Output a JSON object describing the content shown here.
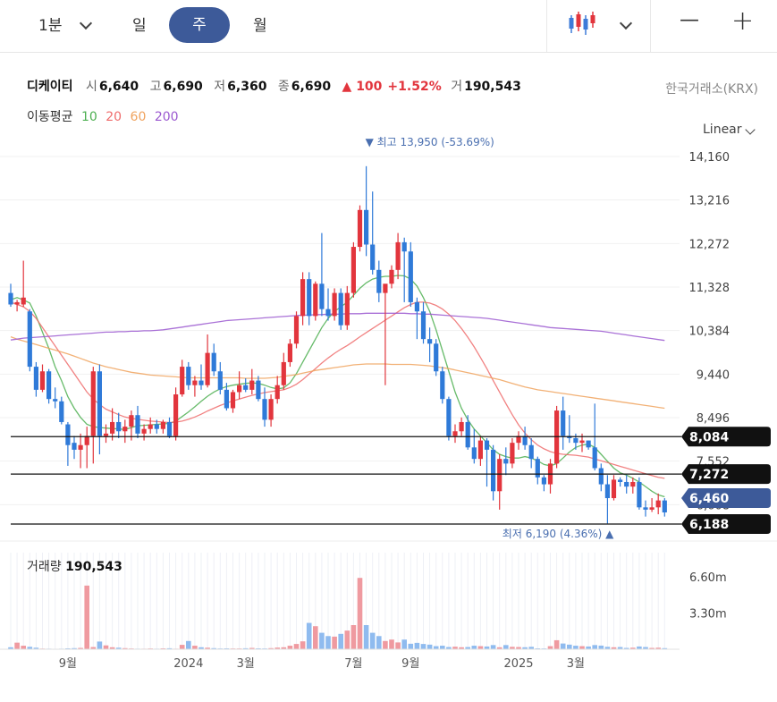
{
  "toolbar": {
    "interval": "1분",
    "tabs": [
      "일",
      "주",
      "월"
    ],
    "active_tab": "주",
    "zoom_out": "—",
    "zoom_in": "+"
  },
  "stock": {
    "name": "디케이티",
    "open_label": "시",
    "open": "6,640",
    "high_label": "고",
    "high": "6,690",
    "low_label": "저",
    "low": "6,360",
    "close_label": "종",
    "close": "6,690",
    "change": "▲ 100",
    "change_pct": "+1.52%",
    "volume_label": "거",
    "volume": "190,543",
    "exchange": "한국거래소(KRX)"
  },
  "moving_average": {
    "label": "이동평균",
    "periods": [
      {
        "name": "10",
        "color": "#4caf50"
      },
      {
        "name": "20",
        "color": "#ef6c6c"
      },
      {
        "name": "60",
        "color": "#f0a35e"
      },
      {
        "name": "200",
        "color": "#9b59d0"
      }
    ]
  },
  "scale": "Linear",
  "chart_data": {
    "type": "candlestick",
    "ylim": [
      6188,
      14160
    ],
    "y_ticks": [
      14160,
      13216,
      12272,
      11328,
      10384,
      9440,
      8496,
      7552,
      6608
    ],
    "y_tick_labels": [
      "14,160",
      "13,216",
      "12,272",
      "11,328",
      "10,384",
      "9,440",
      "8,496",
      "7,552",
      "6,608"
    ],
    "x_tick_labels": [
      {
        "label": "9월",
        "index": 9
      },
      {
        "label": "2024",
        "index": 28
      },
      {
        "label": "3월",
        "index": 37
      },
      {
        "label": "7월",
        "index": 54
      },
      {
        "label": "9월",
        "index": 63
      },
      {
        "label": "2025",
        "index": 80
      },
      {
        "label": "3월",
        "index": 89
      }
    ],
    "horizontal_lines": [
      {
        "value": 8084,
        "label": "8,084",
        "color": "#111111"
      },
      {
        "value": 7272,
        "label": "7,272",
        "color": "#111111"
      },
      {
        "value": 6188,
        "label": "6,188",
        "color": "#111111"
      }
    ],
    "current_price": {
      "value": 6460,
      "label": "6,460",
      "color": "#3d5a99"
    },
    "high_marker": {
      "text": "▼ 최고 13,950 (-53.69%)",
      "index": 56,
      "value": 13950
    },
    "low_marker": {
      "text": "최저 6,190 (4.36%) ▲",
      "index": 94,
      "value": 6190
    },
    "volume_label": "거래량",
    "volume_value": "190,543",
    "volume_ticks": [
      {
        "value": 6.6,
        "label": "6.60m"
      },
      {
        "value": 3.3,
        "label": "3.30m"
      }
    ],
    "volume_max": 8.8,
    "candles": [
      [
        11200,
        11400,
        10900,
        10950
      ],
      [
        10950,
        11050,
        10800,
        11000
      ],
      [
        10950,
        11900,
        10900,
        11100
      ],
      [
        10800,
        10850,
        9500,
        9600
      ],
      [
        9600,
        9700,
        8950,
        9100
      ],
      [
        9100,
        9650,
        9050,
        9500
      ],
      [
        9500,
        9550,
        8800,
        8900
      ],
      [
        8900,
        9150,
        8700,
        8850
      ],
      [
        8850,
        8950,
        8350,
        8400
      ],
      [
        8350,
        8400,
        7450,
        7900
      ],
      [
        7950,
        8100,
        7600,
        7800
      ],
      [
        7800,
        8150,
        7400,
        7900
      ],
      [
        7900,
        8300,
        7400,
        8100
      ],
      [
        8100,
        9600,
        7500,
        9500
      ],
      [
        9500,
        9650,
        7700,
        8100
      ],
      [
        8100,
        8350,
        7950,
        8150
      ],
      [
        8150,
        8700,
        8000,
        8400
      ],
      [
        8400,
        8600,
        8050,
        8200
      ],
      [
        8200,
        8450,
        7950,
        8300
      ],
      [
        8300,
        8650,
        8000,
        8550
      ],
      [
        8550,
        8750,
        8050,
        8150
      ],
      [
        8150,
        8350,
        8000,
        8250
      ],
      [
        8250,
        8500,
        8150,
        8350
      ],
      [
        8350,
        8450,
        8150,
        8250
      ],
      [
        8250,
        8450,
        8150,
        8400
      ],
      [
        8400,
        8500,
        8050,
        8100
      ],
      [
        8100,
        9150,
        8000,
        9000
      ],
      [
        9000,
        9750,
        8950,
        9600
      ],
      [
        9600,
        9700,
        9100,
        9200
      ],
      [
        9200,
        9400,
        8950,
        9300
      ],
      [
        9300,
        9650,
        9100,
        9200
      ],
      [
        9200,
        10300,
        9150,
        9900
      ],
      [
        9900,
        10100,
        9400,
        9500
      ],
      [
        9500,
        9700,
        9000,
        9100
      ],
      [
        9100,
        9250,
        8650,
        8700
      ],
      [
        8700,
        9100,
        8600,
        9050
      ],
      [
        9050,
        9500,
        8900,
        9200
      ],
      [
        9200,
        9350,
        9050,
        9100
      ],
      [
        9100,
        9550,
        9000,
        9300
      ],
      [
        9300,
        9400,
        8850,
        8900
      ],
      [
        8900,
        9150,
        8300,
        8450
      ],
      [
        8450,
        9000,
        8300,
        8900
      ],
      [
        8900,
        9400,
        8800,
        9200
      ],
      [
        9200,
        9900,
        9100,
        9700
      ],
      [
        9700,
        10200,
        9600,
        10100
      ],
      [
        10100,
        10800,
        10000,
        10700
      ],
      [
        10700,
        11650,
        10500,
        11500
      ],
      [
        11500,
        11650,
        10500,
        10700
      ],
      [
        10700,
        11450,
        10600,
        11400
      ],
      [
        11400,
        12500,
        10700,
        10850
      ],
      [
        10850,
        11300,
        10600,
        10700
      ],
      [
        10700,
        11300,
        10600,
        11200
      ],
      [
        11200,
        11300,
        10400,
        10500
      ],
      [
        10500,
        11350,
        10400,
        11200
      ],
      [
        11200,
        12300,
        11100,
        12200
      ],
      [
        12200,
        13100,
        12100,
        13000
      ],
      [
        13000,
        13950,
        12000,
        12250
      ],
      [
        12250,
        13400,
        11600,
        11700
      ],
      [
        11700,
        11900,
        11000,
        11200
      ],
      [
        11200,
        11300,
        9200,
        11400
      ],
      [
        11400,
        11800,
        11300,
        11700
      ],
      [
        11700,
        12500,
        11500,
        12300
      ],
      [
        12300,
        12400,
        11000,
        12100
      ],
      [
        12100,
        12300,
        10900,
        11000
      ],
      [
        11000,
        11100,
        10200,
        10800
      ],
      [
        10800,
        11000,
        10100,
        10200
      ],
      [
        10200,
        10450,
        9700,
        10100
      ],
      [
        10100,
        10200,
        9400,
        9500
      ],
      [
        9500,
        9600,
        8800,
        8900
      ],
      [
        8900,
        8950,
        8000,
        8100
      ],
      [
        8100,
        8350,
        7950,
        8200
      ],
      [
        8200,
        8500,
        8100,
        8400
      ],
      [
        8400,
        8550,
        7800,
        7850
      ],
      [
        7850,
        8250,
        7500,
        7600
      ],
      [
        7600,
        8100,
        7450,
        8000
      ],
      [
        8000,
        8050,
        7000,
        7800
      ],
      [
        7800,
        7900,
        6700,
        6900
      ],
      [
        6900,
        7700,
        6500,
        7600
      ],
      [
        7600,
        7850,
        7250,
        7500
      ],
      [
        7500,
        8050,
        7400,
        7950
      ],
      [
        7950,
        8200,
        7800,
        8100
      ],
      [
        8100,
        8300,
        7800,
        7900
      ],
      [
        7900,
        8050,
        7400,
        7600
      ],
      [
        7600,
        7650,
        7050,
        7200
      ],
      [
        7200,
        7250,
        6900,
        7050
      ],
      [
        7050,
        7600,
        6850,
        7500
      ],
      [
        7500,
        8750,
        7400,
        8650
      ],
      [
        8650,
        8950,
        7800,
        8100
      ],
      [
        8100,
        8550,
        7950,
        8050
      ],
      [
        8050,
        8150,
        7800,
        7950
      ],
      [
        7950,
        8150,
        7750,
        8000
      ],
      [
        8000,
        8000,
        7800,
        7850
      ],
      [
        7850,
        8800,
        7350,
        7400
      ],
      [
        7400,
        7500,
        6900,
        7050
      ],
      [
        7050,
        7250,
        6200,
        6750
      ],
      [
        6750,
        7250,
        6700,
        7150
      ],
      [
        7150,
        7200,
        7000,
        7100
      ],
      [
        7100,
        7250,
        6850,
        7000
      ],
      [
        7000,
        7200,
        6850,
        7100
      ],
      [
        7100,
        7200,
        6500,
        6550
      ],
      [
        6550,
        6700,
        6350,
        6500
      ],
      [
        6500,
        6750,
        6450,
        6550
      ],
      [
        6550,
        6850,
        6400,
        6700
      ],
      [
        6700,
        6750,
        6350,
        6440
      ]
    ],
    "volumes": [
      0.18,
      0.6,
      0.32,
      0.22,
      0.14,
      0.06,
      0.05,
      0.04,
      0.05,
      0.08,
      0.1,
      0.12,
      5.8,
      0.2,
      0.7,
      0.35,
      0.18,
      0.14,
      0.1,
      0.07,
      0.05,
      0.05,
      0.07,
      0.05,
      0.08,
      0.09,
      0.05,
      0.4,
      0.75,
      0.32,
      0.18,
      0.14,
      0.1,
      0.07,
      0.08,
      0.07,
      0.07,
      0.09,
      0.12,
      0.08,
      0.07,
      0.1,
      0.15,
      0.18,
      0.32,
      0.48,
      0.72,
      2.4,
      2.1,
      1.5,
      1.2,
      1.15,
      1.4,
      1.7,
      2.2,
      6.5,
      2.2,
      1.5,
      1.2,
      0.75,
      0.88,
      0.62,
      0.88,
      0.5,
      0.58,
      0.48,
      0.42,
      0.28,
      0.32,
      0.2,
      0.23,
      0.18,
      0.2,
      0.32,
      0.28,
      0.25,
      0.38,
      0.18,
      0.38,
      0.22,
      0.2,
      0.18,
      0.22,
      0.08,
      0.07,
      0.28,
      0.82,
      0.52,
      0.42,
      0.32,
      0.28,
      0.25,
      0.38,
      0.33,
      0.22,
      0.18,
      0.2,
      0.12,
      0.14,
      0.25,
      0.2,
      0.12,
      0.14,
      0.1
    ],
    "ma_series": {
      "10": [
        11050,
        11100,
        11050,
        10980,
        10700,
        10350,
        10000,
        9600,
        9300,
        8950,
        8700,
        8500,
        8350,
        8300,
        8280,
        8270,
        8260,
        8250,
        8240,
        8280,
        8320,
        8330,
        8340,
        8350,
        8360,
        8370,
        8420,
        8520,
        8620,
        8730,
        8850,
        8960,
        9050,
        9120,
        9170,
        9200,
        9220,
        9240,
        9250,
        9240,
        9200,
        9150,
        9120,
        9140,
        9250,
        9450,
        9700,
        9950,
        10200,
        10450,
        10650,
        10800,
        10900,
        11000,
        11150,
        11300,
        11420,
        11500,
        11540,
        11560,
        11560,
        11580,
        11570,
        11500,
        11350,
        11100,
        10800,
        10400,
        9950,
        9500,
        9050,
        8700,
        8450,
        8250,
        8100,
        7950,
        7800,
        7700,
        7650,
        7620,
        7620,
        7650,
        7620,
        7560,
        7480,
        7450,
        7500,
        7620,
        7750,
        7850,
        7900,
        7920,
        7850,
        7700,
        7550,
        7400,
        7300,
        7250,
        7180,
        7100,
        7000,
        6900,
        6820,
        6780
      ],
      "20": [
        11000,
        10950,
        10900,
        10800,
        10650,
        10450,
        10250,
        10050,
        9850,
        9650,
        9450,
        9250,
        9050,
        8900,
        8780,
        8680,
        8620,
        8560,
        8510,
        8480,
        8460,
        8440,
        8420,
        8410,
        8400,
        8390,
        8400,
        8420,
        8460,
        8510,
        8570,
        8640,
        8700,
        8760,
        8810,
        8860,
        8900,
        8940,
        8980,
        9010,
        9040,
        9060,
        9080,
        9100,
        9150,
        9220,
        9320,
        9440,
        9560,
        9680,
        9790,
        9890,
        9980,
        10060,
        10150,
        10250,
        10340,
        10430,
        10520,
        10610,
        10700,
        10790,
        10880,
        10950,
        11000,
        11000,
        10980,
        10930,
        10850,
        10740,
        10600,
        10430,
        10240,
        10030,
        9800,
        9560,
        9300,
        9050,
        8800,
        8560,
        8340,
        8160,
        8020,
        7900,
        7820,
        7760,
        7720,
        7700,
        7690,
        7680,
        7660,
        7640,
        7600,
        7560,
        7520,
        7480,
        7440,
        7400,
        7360,
        7320,
        7280,
        7240,
        7200,
        7180
      ],
      "60": [
        10250,
        10200,
        10160,
        10120,
        10080,
        10040,
        10000,
        9960,
        9920,
        9880,
        9830,
        9780,
        9730,
        9680,
        9640,
        9600,
        9570,
        9540,
        9510,
        9480,
        9460,
        9440,
        9420,
        9410,
        9400,
        9390,
        9380,
        9370,
        9360,
        9360,
        9360,
        9360,
        9360,
        9360,
        9360,
        9360,
        9360,
        9350,
        9350,
        9350,
        9350,
        9360,
        9370,
        9390,
        9410,
        9430,
        9460,
        9490,
        9520,
        9540,
        9560,
        9580,
        9600,
        9620,
        9640,
        9650,
        9660,
        9660,
        9660,
        9660,
        9650,
        9650,
        9650,
        9650,
        9640,
        9630,
        9620,
        9600,
        9580,
        9560,
        9530,
        9500,
        9470,
        9440,
        9410,
        9380,
        9350,
        9320,
        9280,
        9240,
        9200,
        9160,
        9130,
        9100,
        9080,
        9060,
        9040,
        9020,
        9000,
        8980,
        8960,
        8940,
        8920,
        8900,
        8880,
        8860,
        8840,
        8820,
        8800,
        8780,
        8760,
        8740,
        8720,
        8700
      ],
      "200": [
        10180,
        10200,
        10220,
        10230,
        10240,
        10250,
        10260,
        10270,
        10280,
        10290,
        10300,
        10310,
        10320,
        10330,
        10340,
        10350,
        10350,
        10360,
        10360,
        10370,
        10370,
        10380,
        10380,
        10390,
        10400,
        10420,
        10440,
        10460,
        10480,
        10500,
        10520,
        10540,
        10560,
        10580,
        10600,
        10610,
        10620,
        10630,
        10640,
        10650,
        10660,
        10670,
        10680,
        10690,
        10700,
        10710,
        10720,
        10720,
        10730,
        10730,
        10740,
        10740,
        10740,
        10750,
        10750,
        10750,
        10760,
        10760,
        10760,
        10760,
        10760,
        10760,
        10760,
        10750,
        10750,
        10740,
        10740,
        10730,
        10720,
        10710,
        10700,
        10690,
        10680,
        10670,
        10660,
        10650,
        10630,
        10610,
        10590,
        10570,
        10550,
        10530,
        10510,
        10490,
        10470,
        10450,
        10440,
        10430,
        10420,
        10410,
        10400,
        10390,
        10380,
        10370,
        10350,
        10330,
        10310,
        10290,
        10270,
        10250,
        10230,
        10210,
        10190,
        10170
      ]
    }
  }
}
